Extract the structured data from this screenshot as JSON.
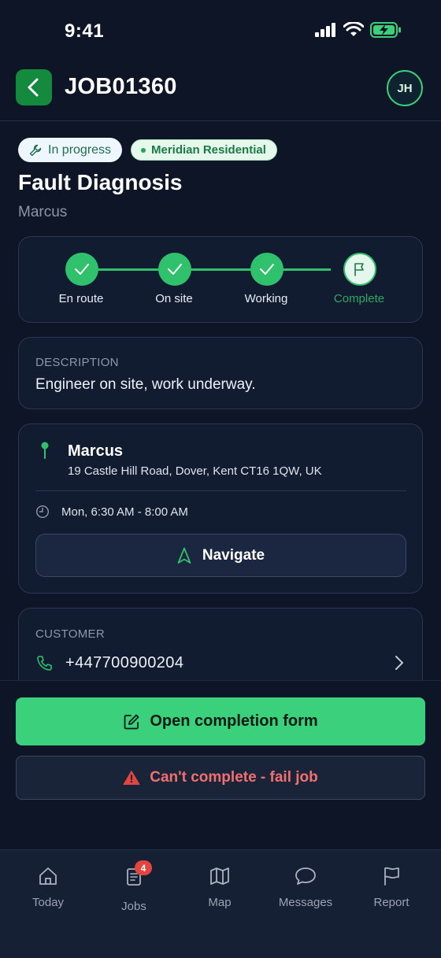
{
  "status_bar": {
    "time": "9:41"
  },
  "header": {
    "job_id": "JOB01360",
    "avatar_initials": "JH"
  },
  "job": {
    "status_badge": "In progress",
    "client_badge": "Meridian Residential",
    "title": "Fault Diagnosis",
    "engineer": "Marcus"
  },
  "progress": {
    "steps": [
      {
        "label": "En route",
        "state": "done"
      },
      {
        "label": "On site",
        "state": "done"
      },
      {
        "label": "Working",
        "state": "done"
      },
      {
        "label": "Complete",
        "state": "current"
      }
    ]
  },
  "description": {
    "label": "DESCRIPTION",
    "text": "Engineer on site, work underway."
  },
  "location": {
    "name": "Marcus",
    "address": "19 Castle Hill Road, Dover, Kent CT16 1QW, UK",
    "time_window": "Mon, 6:30 AM - 8:00 AM",
    "navigate_label": "Navigate"
  },
  "customer": {
    "label": "CUSTOMER",
    "phone": "+447700900204"
  },
  "actions": {
    "complete_label": "Open completion form",
    "fail_label": "Can't complete - fail job"
  },
  "tabbar": {
    "items": [
      {
        "label": "Today",
        "icon": "home-icon"
      },
      {
        "label": "Jobs",
        "icon": "clipboard-icon",
        "badge": "4"
      },
      {
        "label": "Map",
        "icon": "map-icon"
      },
      {
        "label": "Messages",
        "icon": "message-icon"
      },
      {
        "label": "Report",
        "icon": "flag-icon"
      }
    ]
  },
  "colors": {
    "background": "#0d1526",
    "accent_green": "#3bd07c",
    "danger_red": "#f07070",
    "badge_red": "#e2453f"
  }
}
